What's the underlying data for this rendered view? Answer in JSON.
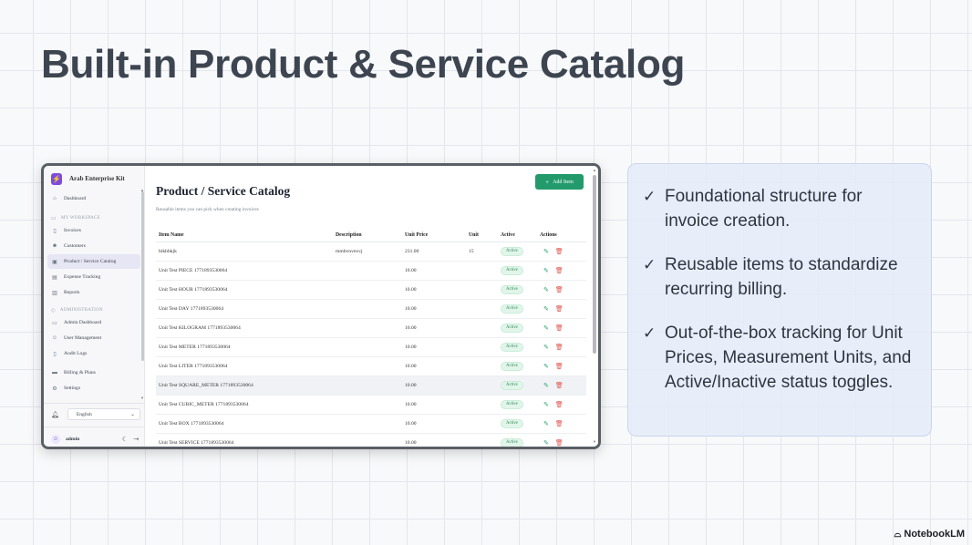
{
  "slide": {
    "title": "Built-in Product & Service Catalog",
    "watermark": "NotebookLM"
  },
  "app": {
    "brand": "Arab Enterprise Kit",
    "sidebar": {
      "dashboard": "Dashboard",
      "workspace_section": "MY WORKSPACE",
      "workspace_items": [
        "Invoices",
        "Customers",
        "Product / Service Catalog",
        "Expense Tracking",
        "Reports"
      ],
      "admin_section": "ADMINISTRATION",
      "admin_items": [
        "Admin Dashboard",
        "User Management",
        "Audit Logs"
      ],
      "other_items": [
        "Billing & Plans",
        "Settings"
      ],
      "language": "English",
      "user": "admin"
    },
    "page": {
      "title": "Product / Service Catalog",
      "subtitle": "Reusable items you can pick when creating invoices",
      "add_button": "Add Item"
    },
    "table": {
      "headers": [
        "Item Name",
        "Description",
        "Unit Price",
        "Unit",
        "Active",
        "Actions"
      ],
      "rows": [
        {
          "name": "bikbbkjk",
          "description": "mmbvnvnvcj",
          "price": "231.00",
          "unit": "15",
          "active": "Active"
        },
        {
          "name": "Unit Test PIECE 1771893530064",
          "description": "",
          "price": "10.00",
          "unit": "",
          "active": "Active"
        },
        {
          "name": "Unit Test HOUR 1771893530064",
          "description": "",
          "price": "10.00",
          "unit": "",
          "active": "Active"
        },
        {
          "name": "Unit Test DAY 1771893530064",
          "description": "",
          "price": "10.00",
          "unit": "",
          "active": "Active"
        },
        {
          "name": "Unit Test KILOGRAM 1771893530064",
          "description": "",
          "price": "10.00",
          "unit": "",
          "active": "Active"
        },
        {
          "name": "Unit Test METER 1771893530064",
          "description": "",
          "price": "10.00",
          "unit": "",
          "active": "Active"
        },
        {
          "name": "Unit Test LITER 1771893530064",
          "description": "",
          "price": "10.00",
          "unit": "",
          "active": "Active"
        },
        {
          "name": "Unit Test SQUARE_METER 1771893530064",
          "description": "",
          "price": "10.00",
          "unit": "",
          "active": "Active"
        },
        {
          "name": "Unit Test CUBIC_METER 1771893530064",
          "description": "",
          "price": "10.00",
          "unit": "",
          "active": "Active"
        },
        {
          "name": "Unit Test BOX 1771893530064",
          "description": "",
          "price": "10.00",
          "unit": "",
          "active": "Active"
        },
        {
          "name": "Unit Test SERVICE 1771893530064",
          "description": "",
          "price": "10.00",
          "unit": "",
          "active": "Active"
        }
      ]
    }
  },
  "features": [
    "Foundational structure for invoice creation.",
    "Reusable items to standardize recurring billing.",
    "Out-of-the-box tracking for Unit Prices, Measurement Units, and Active/Inactive status toggles."
  ]
}
